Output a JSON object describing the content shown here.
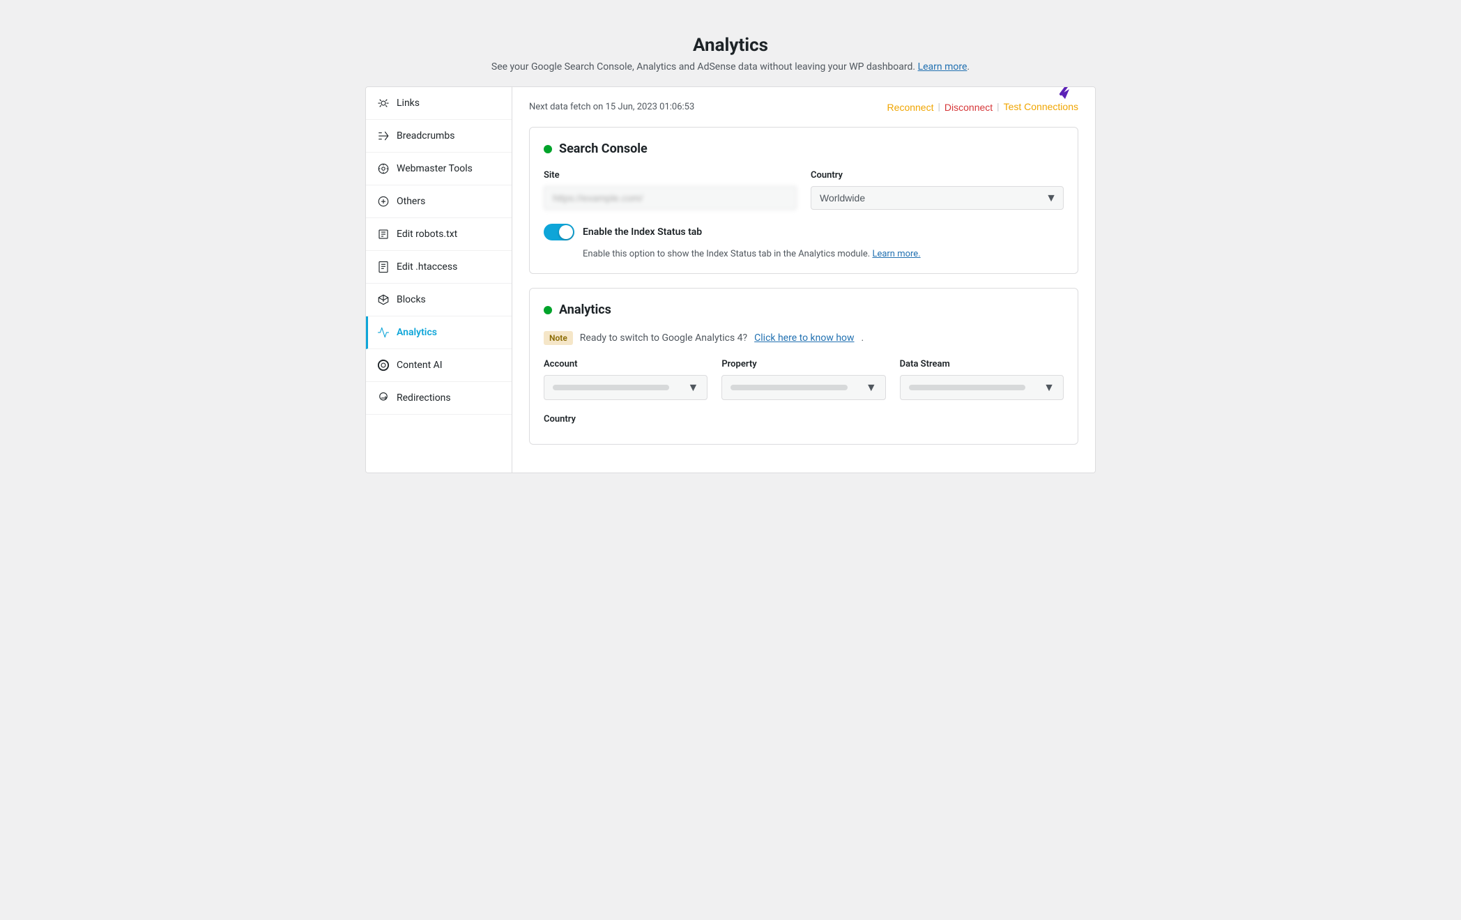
{
  "page": {
    "title": "Analytics",
    "subtitle": "See your Google Search Console, Analytics and AdSense data without leaving your WP dashboard.",
    "learn_more_text": "Learn more",
    "learn_more_url": "#"
  },
  "top_bar": {
    "next_fetch_text": "Next data fetch on 15 Jun, 2023 01:06:53",
    "reconnect_label": "Reconnect",
    "disconnect_label": "Disconnect",
    "test_connections_label": "Test Connections"
  },
  "sidebar": {
    "items": [
      {
        "id": "links",
        "label": "Links",
        "icon": "links-icon"
      },
      {
        "id": "breadcrumbs",
        "label": "Breadcrumbs",
        "icon": "breadcrumbs-icon"
      },
      {
        "id": "webmaster-tools",
        "label": "Webmaster Tools",
        "icon": "webmaster-tools-icon"
      },
      {
        "id": "others",
        "label": "Others",
        "icon": "others-icon"
      },
      {
        "id": "edit-robots",
        "label": "Edit robots.txt",
        "icon": "robots-icon"
      },
      {
        "id": "edit-htaccess",
        "label": "Edit .htaccess",
        "icon": "htaccess-icon"
      },
      {
        "id": "blocks",
        "label": "Blocks",
        "icon": "blocks-icon"
      },
      {
        "id": "analytics",
        "label": "Analytics",
        "icon": "analytics-icon",
        "active": true
      },
      {
        "id": "content-ai",
        "label": "Content AI",
        "icon": "content-ai-icon"
      },
      {
        "id": "redirections",
        "label": "Redirections",
        "icon": "redirections-icon"
      }
    ]
  },
  "search_console_card": {
    "title": "Search Console",
    "status": "connected",
    "site_label": "Site",
    "site_placeholder": "https://example.com/",
    "country_label": "Country",
    "country_value": "Worldwide",
    "toggle_label": "Enable the Index Status tab",
    "toggle_description": "Enable this option to show the Index Status tab in the Analytics module.",
    "toggle_learn_more": "Learn more.",
    "toggle_learn_more_url": "#",
    "toggle_enabled": true
  },
  "analytics_card": {
    "title": "Analytics",
    "status": "connected",
    "note_label": "Note",
    "note_text": "Ready to switch to Google Analytics 4?",
    "note_link_text": "Click here to know how",
    "note_link_url": "#",
    "account_label": "Account",
    "property_label": "Property",
    "data_stream_label": "Data Stream",
    "country_label": "Country"
  }
}
